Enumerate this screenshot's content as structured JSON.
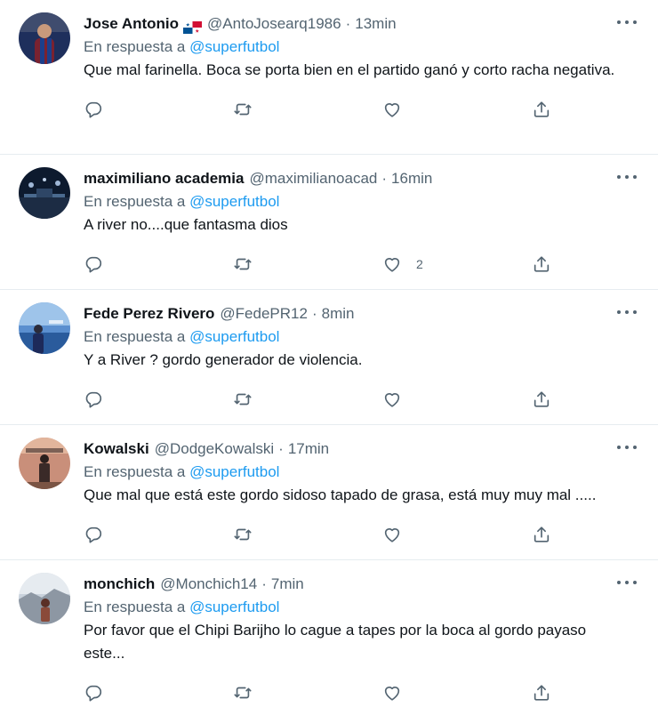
{
  "reply_prefix": "En respuesta a",
  "tweets": [
    {
      "name": "Jose Antonio",
      "has_flag": true,
      "handle": "@AntoJosearq1986",
      "separator": "·",
      "time": "13min",
      "mention": "@superfutbol",
      "text": "Que mal farinella. Boca se porta bien en el partido ganó y corto racha negativa.",
      "like_count": "",
      "avatar_colors": [
        "#1e2f5c",
        "#7a2230"
      ]
    },
    {
      "name": "maximiliano academia",
      "has_flag": false,
      "handle": "@maximilianoacad",
      "separator": "·",
      "time": "16min",
      "mention": "@superfutbol",
      "text": "A river no....que fantasma dios",
      "like_count": "2",
      "avatar_colors": [
        "#0d1a2e",
        "#4a6a8e"
      ]
    },
    {
      "name": "Fede Perez Rivero",
      "has_flag": false,
      "handle": "@FedePR12",
      "separator": "·",
      "time": "8min",
      "mention": "@superfutbol",
      "text": "Y a River ? gordo generador de violencia.",
      "like_count": "",
      "avatar_colors": [
        "#2a5b9c",
        "#9ec4ea"
      ]
    },
    {
      "name": "Kowalski",
      "has_flag": false,
      "handle": "@DodgeKowalski",
      "separator": "·",
      "time": "17min",
      "mention": "@superfutbol",
      "text": "Que mal que está este gordo sidoso tapado de grasa, está muy muy mal .....",
      "like_count": "",
      "avatar_colors": [
        "#c98f7a",
        "#3a2a28"
      ]
    },
    {
      "name": "monchich",
      "has_flag": false,
      "handle": "@Monchich14",
      "separator": "·",
      "time": "7min",
      "mention": "@superfutbol",
      "text": "Por favor que el Chipi Barijho lo cague a tapes por la boca al gordo payaso este...",
      "like_count": "",
      "avatar_colors": [
        "#c9d2dc",
        "#8a4a3a"
      ]
    }
  ],
  "colors": {
    "text": "#0f1419",
    "secondary": "#536471",
    "link": "#1d9bf0",
    "divider": "#e6ecf0"
  },
  "icons": [
    "reply-icon",
    "retweet-icon",
    "like-icon",
    "share-icon",
    "more-icon"
  ]
}
